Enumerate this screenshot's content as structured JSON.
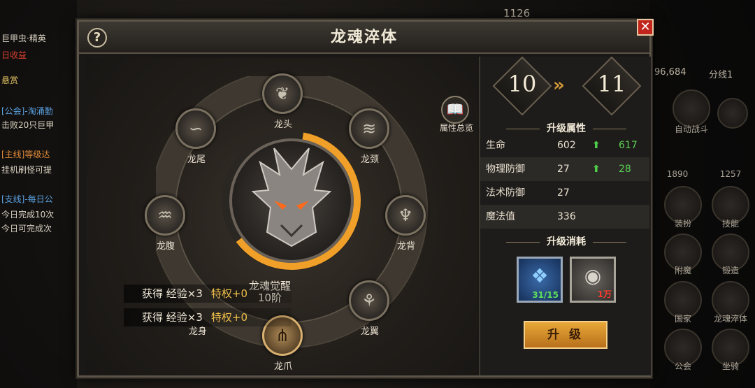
{
  "panel": {
    "title": "龙魂淬体",
    "help": "?",
    "close": "✕"
  },
  "overview": {
    "label": "属性总览",
    "icon": "book-icon"
  },
  "nodes": [
    {
      "label": "龙头",
      "icon": "dragon-head-icon",
      "glyph": "❦"
    },
    {
      "label": "龙颈",
      "icon": "dragon-neck-icon",
      "glyph": "≋"
    },
    {
      "label": "龙背",
      "icon": "dragon-back-icon",
      "glyph": "♆"
    },
    {
      "label": "龙翼",
      "icon": "dragon-wing-icon",
      "glyph": "⚘"
    },
    {
      "label": "龙爪",
      "icon": "dragon-claw-icon",
      "glyph": "⋔"
    },
    {
      "label": "龙身",
      "icon": "dragon-body-icon",
      "glyph": "⌇"
    },
    {
      "label": "龙腹",
      "icon": "dragon-belly-icon",
      "glyph": "♒"
    },
    {
      "label": "龙尾",
      "icon": "dragon-tail-icon",
      "glyph": "∽"
    }
  ],
  "center": {
    "name": "龙魂觉醒",
    "level": "10阶",
    "progress": 0.62
  },
  "rewards": [
    {
      "text": "获得 经验×3",
      "bonus": "特权+0"
    },
    {
      "text": "获得 经验×3",
      "bonus": "特权+0"
    }
  ],
  "level": {
    "from": "10",
    "to": "11"
  },
  "upgrade_attrs": {
    "title": "升级属性",
    "rows": [
      {
        "name": "生命",
        "value": "602",
        "next": "617"
      },
      {
        "name": "物理防御",
        "value": "27",
        "next": "28"
      },
      {
        "name": "法术防御",
        "value": "27",
        "next": ""
      },
      {
        "name": "魔法值",
        "value": "336",
        "next": ""
      }
    ]
  },
  "upgrade_cost": {
    "title": "升级消耗",
    "items": [
      {
        "icon": "blue-crystal-icon",
        "count": "31/15",
        "count_color": "#5ce05a"
      },
      {
        "icon": "silver-coin-icon",
        "count": "1万",
        "count_color": "#ff3a2a"
      }
    ]
  },
  "upgrade_button": "升 级",
  "hud": {
    "left_lines": [
      "巨甲虫·精英",
      "日收益",
      "悬赏",
      "[公会]-淘涌勤",
      "击败20只巨甲",
      "[主线]等级达",
      "挂机刷怪可提",
      "[支线]-每日公",
      "今日完成10次",
      "今日可完成次"
    ],
    "map_coords": "96,684",
    "map_line": "分线1",
    "top_number": "1126",
    "right_labels": [
      "自动战斗",
      "1890",
      "1257",
      "装扮",
      "技能",
      "附魔",
      "锻造",
      "国家",
      "龙魂淬体",
      "公会",
      "坐骑"
    ]
  }
}
